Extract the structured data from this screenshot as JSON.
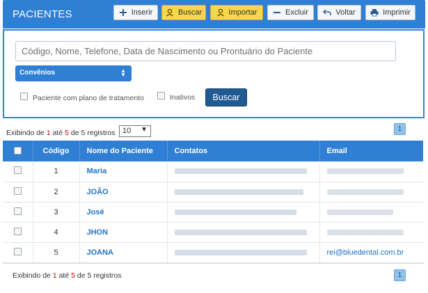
{
  "header": {
    "title": "PACIENTES",
    "buttons": [
      {
        "label": "Inserir",
        "icon": "plus-icon",
        "style": "default"
      },
      {
        "label": "Buscar",
        "icon": "user-search-icon",
        "style": "yellow"
      },
      {
        "label": "Importar",
        "icon": "user-import-icon",
        "style": "yellow"
      },
      {
        "label": "Excluir",
        "icon": "minus-icon",
        "style": "default"
      },
      {
        "label": "Voltar",
        "icon": "undo-icon",
        "style": "default"
      },
      {
        "label": "Imprimir",
        "icon": "print-icon",
        "style": "default"
      }
    ]
  },
  "search": {
    "placeholder": "Código, Nome, Telefone, Data de Nascimento ou Prontuário do Paciente",
    "convenios_label": "Convênios",
    "checkbox_plano": "Paciente com plano de tratamento",
    "checkbox_inativos": "Inativos",
    "button": "Buscar"
  },
  "pagination_top": {
    "prefix": "Exibindo de",
    "from": "1",
    "to_word": "até",
    "to": "5",
    "of_word": "de",
    "total": "5",
    "suffix": "registros",
    "page_size": "10",
    "page": "1"
  },
  "table": {
    "columns": [
      "Código",
      "Nome do Paciente",
      "Contatos",
      "Email"
    ],
    "rows": [
      {
        "code": "1",
        "name": "Maria",
        "email": ""
      },
      {
        "code": "2",
        "name": "JOÃO",
        "email": ""
      },
      {
        "code": "3",
        "name": "José",
        "email": ""
      },
      {
        "code": "4",
        "name": "JHON",
        "email": ""
      },
      {
        "code": "5",
        "name": "JOANA",
        "email": "rei@bluedental.com.br"
      }
    ]
  },
  "pagination_bottom": {
    "prefix": "Exibindo de",
    "from": "1",
    "to_word": "até",
    "to": "5",
    "of_word": "de",
    "total": "5",
    "suffix": "registros",
    "page": "1"
  },
  "colors": {
    "header_blue": "#2f7fd4",
    "button_yellow": "#f7d84a",
    "search_button": "#1f5b92",
    "link_blue": "#2172c4"
  }
}
